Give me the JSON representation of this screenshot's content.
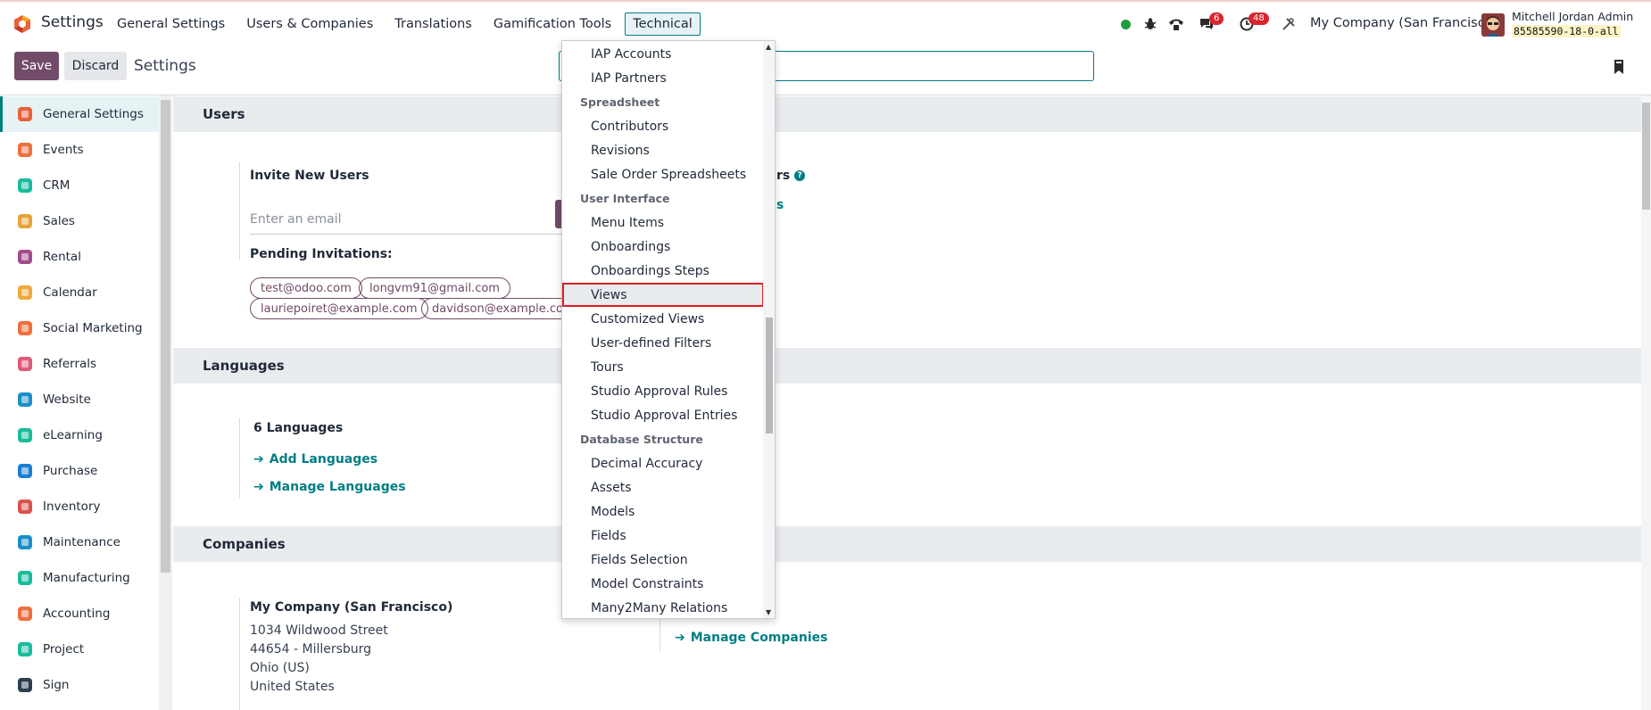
{
  "navbar": {
    "app_name": "Settings",
    "menu": [
      "General Settings",
      "Users & Companies",
      "Translations",
      "Gamification Tools",
      "Technical"
    ],
    "active_menu": "Technical",
    "chat_badge": "6",
    "activity_badge": "48",
    "company": "My Company (San Francisco)",
    "user_name": "Mitchell Jordan Admin",
    "db_name": "85585590-18-0-all"
  },
  "control_panel": {
    "save_label": "Save",
    "discard_label": "Discard",
    "title": "Settings"
  },
  "sidebar": {
    "items": [
      {
        "label": "General Settings",
        "icon": "settings-icon",
        "color": "#e8623a"
      },
      {
        "label": "Events",
        "icon": "events-icon",
        "color": "#f06f3e"
      },
      {
        "label": "CRM",
        "icon": "crm-icon",
        "color": "#1abc9c"
      },
      {
        "label": "Sales",
        "icon": "sales-icon",
        "color": "#e8a23a"
      },
      {
        "label": "Rental",
        "icon": "rental-icon",
        "color": "#a34b8c"
      },
      {
        "label": "Calendar",
        "icon": "calendar-icon",
        "color": "#f0a93e"
      },
      {
        "label": "Social Marketing",
        "icon": "social-marketing-icon",
        "color": "#f06f3e"
      },
      {
        "label": "Referrals",
        "icon": "referrals-icon",
        "color": "#e05a7a"
      },
      {
        "label": "Website",
        "icon": "website-icon",
        "color": "#1a8fc9"
      },
      {
        "label": "eLearning",
        "icon": "elearning-icon",
        "color": "#1abc9c"
      },
      {
        "label": "Purchase",
        "icon": "purchase-icon",
        "color": "#1a7fd4"
      },
      {
        "label": "Inventory",
        "icon": "inventory-icon",
        "color": "#d9534f"
      },
      {
        "label": "Maintenance",
        "icon": "maintenance-icon",
        "color": "#1a8fc9"
      },
      {
        "label": "Manufacturing",
        "icon": "manufacturing-icon",
        "color": "#1abc9c"
      },
      {
        "label": "Accounting",
        "icon": "accounting-icon",
        "color": "#f06f3e"
      },
      {
        "label": "Project",
        "icon": "project-icon",
        "color": "#1abc9c"
      },
      {
        "label": "Sign",
        "icon": "sign-icon",
        "color": "#2c3e50"
      }
    ]
  },
  "users_section": {
    "header": "Users",
    "invite_label": "Invite New Users",
    "email_placeholder": "Enter an email",
    "pending_label": "Pending Invitations:",
    "invitations": [
      "test@odoo.com",
      "longvm91@gmail.com",
      "lauriepoiret@example.com",
      "davidson@example.com"
    ],
    "right_title_fragment": "rs",
    "right_link_fragment": "s"
  },
  "languages_section": {
    "header": "Languages",
    "count_label": "6 Languages",
    "add_link": "Add Languages",
    "manage_link": "Manage Languages"
  },
  "companies_section": {
    "header": "Companies",
    "company_name": "My Company (San Francisco)",
    "address": [
      "1034 Wildwood Street",
      "44654 - Millersburg",
      "Ohio (US)",
      "United States"
    ],
    "manage_link": "Manage Companies"
  },
  "dropdown": {
    "rows": [
      {
        "type": "item",
        "label": "IAP Accounts"
      },
      {
        "type": "item",
        "label": "IAP Partners"
      },
      {
        "type": "group",
        "label": "Spreadsheet"
      },
      {
        "type": "item",
        "label": "Contributors"
      },
      {
        "type": "item",
        "label": "Revisions"
      },
      {
        "type": "item",
        "label": "Sale Order Spreadsheets"
      },
      {
        "type": "group",
        "label": "User Interface"
      },
      {
        "type": "item",
        "label": "Menu Items"
      },
      {
        "type": "item",
        "label": "Onboardings"
      },
      {
        "type": "item",
        "label": "Onboardings Steps"
      },
      {
        "type": "item",
        "label": "Views",
        "highlighted": true
      },
      {
        "type": "item",
        "label": "Customized Views"
      },
      {
        "type": "item",
        "label": "User-defined Filters"
      },
      {
        "type": "item",
        "label": "Tours"
      },
      {
        "type": "item",
        "label": "Studio Approval Rules"
      },
      {
        "type": "item",
        "label": "Studio Approval Entries"
      },
      {
        "type": "group",
        "label": "Database Structure"
      },
      {
        "type": "item",
        "label": "Decimal Accuracy"
      },
      {
        "type": "item",
        "label": "Assets"
      },
      {
        "type": "item",
        "label": "Models"
      },
      {
        "type": "item",
        "label": "Fields"
      },
      {
        "type": "item",
        "label": "Fields Selection"
      },
      {
        "type": "item",
        "label": "Model Constraints"
      },
      {
        "type": "item",
        "label": "Many2Many Relations"
      }
    ]
  },
  "colors": {
    "primary": "#714b67",
    "link": "#017e84",
    "highlight_border": "#e01b24"
  }
}
